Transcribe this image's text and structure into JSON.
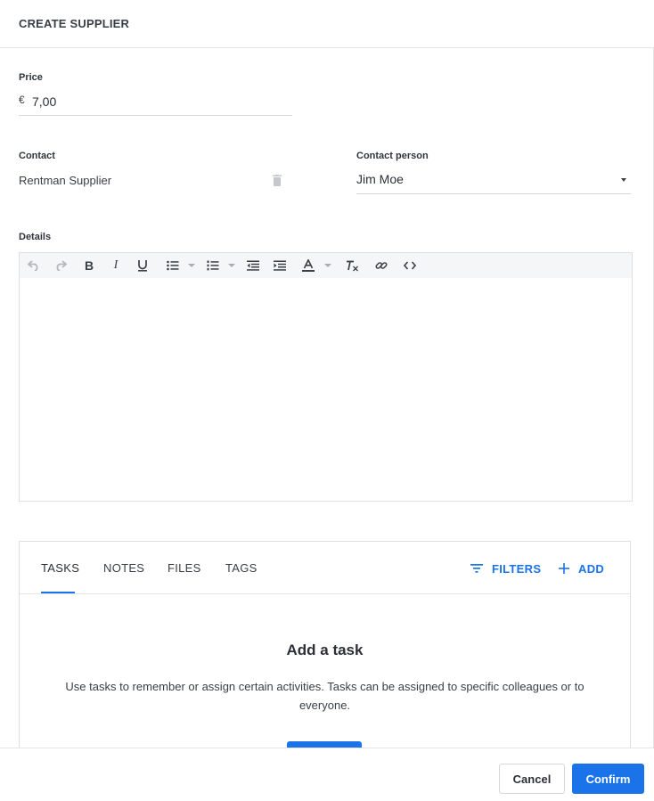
{
  "header": {
    "title": "CREATE SUPPLIER"
  },
  "price": {
    "label": "Price",
    "currency": "€",
    "value": "7,00"
  },
  "contact": {
    "label": "Contact",
    "value": "Rentman Supplier",
    "delete_icon": "trash-icon"
  },
  "contact_person": {
    "label": "Contact person",
    "value": "Jim Moe"
  },
  "details": {
    "label": "Details",
    "toolbar": [
      "undo-icon",
      "redo-icon",
      "bold-icon",
      "italic-icon",
      "underline-icon",
      "bulleted-list-icon",
      "numbered-list-icon",
      "outdent-icon",
      "indent-icon",
      "text-color-icon",
      "clear-formatting-icon",
      "link-icon",
      "source-code-icon"
    ],
    "content": ""
  },
  "tabs": {
    "items": [
      {
        "label": "TASKS",
        "active": true
      },
      {
        "label": "NOTES",
        "active": false
      },
      {
        "label": "FILES",
        "active": false
      },
      {
        "label": "TAGS",
        "active": false
      }
    ],
    "filters_label": "FILTERS",
    "add_label": "ADD"
  },
  "empty_state": {
    "title": "Add a task",
    "text": "Use tasks to remember or assign certain activities. Tasks can be assigned to specific colleagues or to everyone."
  },
  "footer": {
    "cancel_label": "Cancel",
    "confirm_label": "Confirm"
  },
  "colors": {
    "accent": "#1a73e8",
    "border": "#dcdfe3",
    "toolbar_bg": "#f5f6f7",
    "text": "#2c3036"
  }
}
